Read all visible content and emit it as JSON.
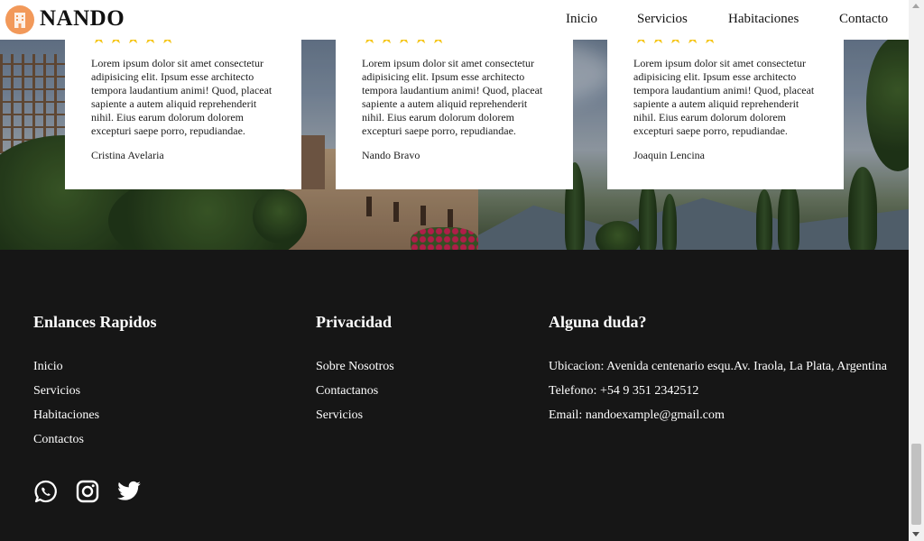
{
  "header": {
    "brand": "NANDO",
    "nav": [
      "Inicio",
      "Servicios",
      "Habitaciones",
      "Contacto"
    ]
  },
  "testimonials": [
    {
      "stars": "★★★★★",
      "text": "Lorem ipsum dolor sit amet consectetur adipisicing elit. Ipsum esse architecto tempora laudantium animi! Quod, placeat sapiente a autem aliquid reprehenderit nihil. Eius earum dolorum dolorem excepturi saepe porro, repudiandae.",
      "author": "Cristina Avelaria"
    },
    {
      "stars": "★★★★★",
      "text": "Lorem ipsum dolor sit amet consectetur adipisicing elit. Ipsum esse architecto tempora laudantium animi! Quod, placeat sapiente a autem aliquid reprehenderit nihil. Eius earum dolorum dolorem excepturi saepe porro, repudiandae.",
      "author": "Nando Bravo"
    },
    {
      "stars": "★★★★★",
      "text": "Lorem ipsum dolor sit amet consectetur adipisicing elit. Ipsum esse architecto tempora laudantium animi! Quod, placeat sapiente a autem aliquid reprehenderit nihil. Eius earum dolorum dolorem excepturi saepe porro, repudiandae.",
      "author": "Joaquin Lencina"
    }
  ],
  "footer": {
    "quick_links": {
      "title": "Enlances Rapidos",
      "items": [
        "Inicio",
        "Servicios",
        "Habitaciones",
        "Contactos"
      ]
    },
    "privacy": {
      "title": "Privacidad",
      "items": [
        "Sobre Nosotros",
        "Contactanos",
        "Servicios"
      ]
    },
    "contact": {
      "title": "Alguna duda?",
      "items": [
        "Ubicacion: Avenida centenario esqu.Av. Iraola, La Plata, Argentina",
        "Telefono: +54 9 351 2342512",
        "Email: nandoexample@gmail.com"
      ]
    },
    "social_icons": [
      "whatsapp-icon",
      "instagram-icon",
      "twitter-icon"
    ]
  },
  "colors": {
    "logo_accent": "#f2995a",
    "star": "#f5c61b",
    "footer_bg": "#161616"
  }
}
